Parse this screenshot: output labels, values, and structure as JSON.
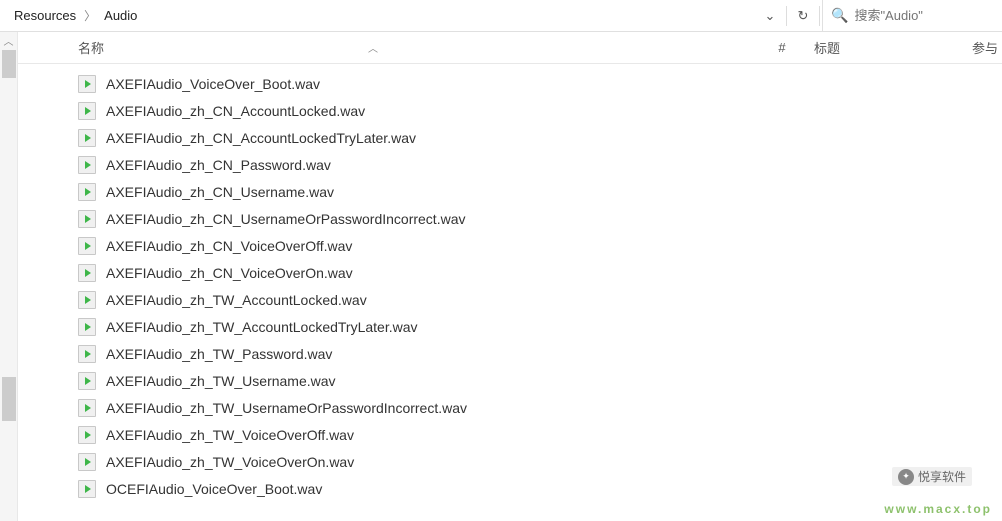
{
  "breadcrumb": {
    "items": [
      {
        "label": "Resources"
      },
      {
        "label": "Audio"
      }
    ]
  },
  "toolbar": {
    "search_placeholder": "搜索\"Audio\""
  },
  "columns": {
    "name": "名称",
    "hash": "#",
    "title": "标题",
    "extra": "参与"
  },
  "files": [
    {
      "name": "AXEFIAudio_VoiceOver_Boot.wav"
    },
    {
      "name": "AXEFIAudio_zh_CN_AccountLocked.wav"
    },
    {
      "name": "AXEFIAudio_zh_CN_AccountLockedTryLater.wav"
    },
    {
      "name": "AXEFIAudio_zh_CN_Password.wav"
    },
    {
      "name": "AXEFIAudio_zh_CN_Username.wav"
    },
    {
      "name": "AXEFIAudio_zh_CN_UsernameOrPasswordIncorrect.wav"
    },
    {
      "name": "AXEFIAudio_zh_CN_VoiceOverOff.wav"
    },
    {
      "name": "AXEFIAudio_zh_CN_VoiceOverOn.wav"
    },
    {
      "name": "AXEFIAudio_zh_TW_AccountLocked.wav"
    },
    {
      "name": "AXEFIAudio_zh_TW_AccountLockedTryLater.wav"
    },
    {
      "name": "AXEFIAudio_zh_TW_Password.wav"
    },
    {
      "name": "AXEFIAudio_zh_TW_Username.wav"
    },
    {
      "name": "AXEFIAudio_zh_TW_UsernameOrPasswordIncorrect.wav"
    },
    {
      "name": "AXEFIAudio_zh_TW_VoiceOverOff.wav"
    },
    {
      "name": "AXEFIAudio_zh_TW_VoiceOverOn.wav"
    },
    {
      "name": "OCEFIAudio_VoiceOver_Boot.wav"
    }
  ],
  "watermark": {
    "badge_text": "悦享软件",
    "url": "www.macx.top"
  }
}
